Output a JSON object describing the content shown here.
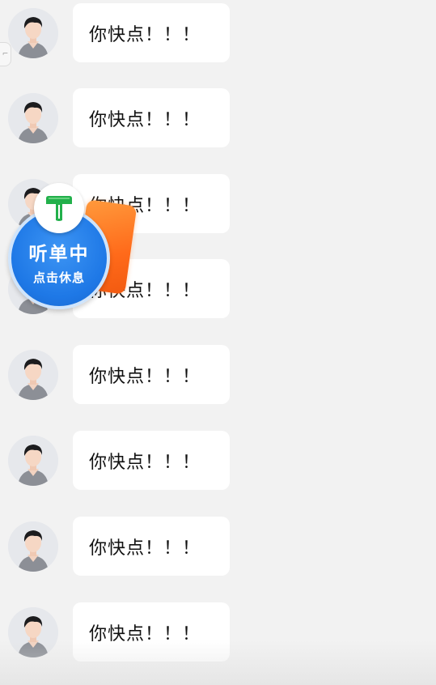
{
  "messages": [
    {
      "text": "你快点！！！"
    },
    {
      "text": "你快点！！！"
    },
    {
      "text": "你快点！！！"
    },
    {
      "text": "你快点！！！"
    },
    {
      "text": "你快点！！！"
    },
    {
      "text": "你快点！！！"
    },
    {
      "text": "你快点！！！"
    },
    {
      "text": "你快点！！！"
    }
  ],
  "side_tab": {
    "label": "⌐"
  },
  "float_widget": {
    "title": "听单中",
    "subtitle": "点击休息",
    "logo_icon": "t-logo-icon",
    "accent_blue": "#1e78e6",
    "accent_orange": "#ff6a1a",
    "logo_green": "#22b04b"
  }
}
